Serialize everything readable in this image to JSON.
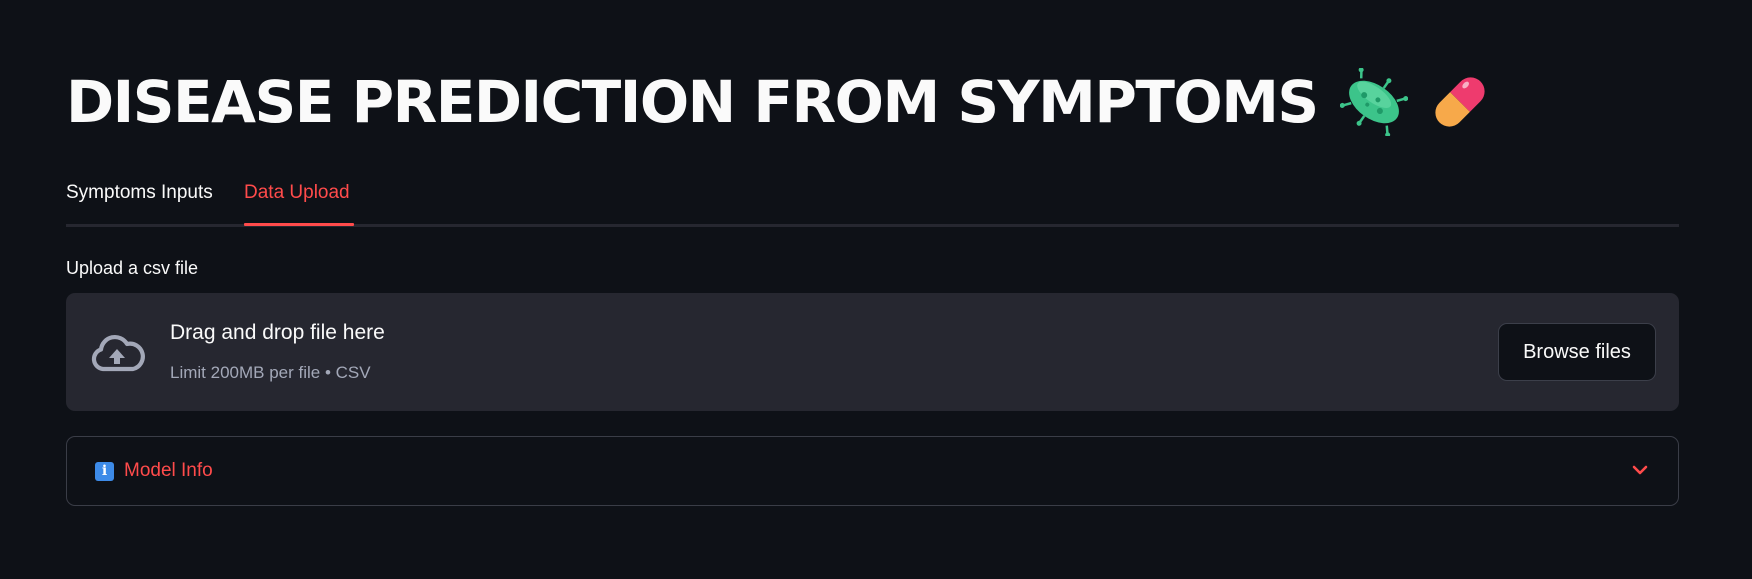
{
  "page": {
    "title": "DISEASE PREDICTION FROM SYMPTOMS",
    "title_icons": [
      "microbe-icon",
      "pill-icon"
    ]
  },
  "tabs": [
    {
      "label": "Symptoms Inputs",
      "active": false
    },
    {
      "label": "Data Upload",
      "active": true
    }
  ],
  "uploader": {
    "label": "Upload a csv file",
    "dropzone_title": "Drag and drop file here",
    "dropzone_hint": "Limit 200MB per file • CSV",
    "browse_label": "Browse files",
    "icon": "cloud-upload-icon"
  },
  "expander": {
    "label": "Model Info",
    "icon": "info-icon",
    "icon_glyph": "i",
    "toggle_icon": "chevron-down-icon",
    "expanded": false
  },
  "colors": {
    "background": "#0e1117",
    "accent": "#ff4b4b",
    "text": "#fafafa",
    "dropzone_bg": "#262730",
    "muted_text": "#a3a8b8"
  }
}
